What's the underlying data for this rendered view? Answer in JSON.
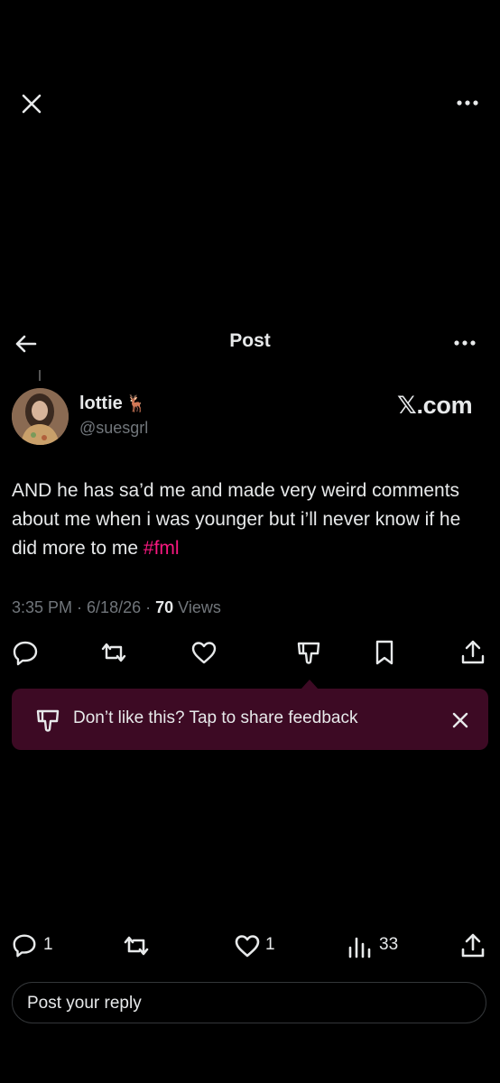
{
  "top_bar": {
    "close_icon": "close-icon",
    "more_icon": "more-icon"
  },
  "nav": {
    "title": "Post",
    "back_icon": "arrow-left-icon",
    "more_icon": "more-icon"
  },
  "post": {
    "display_name": "lottie",
    "name_emoji": "🦌",
    "handle": "@suesgrl",
    "badge_text": "𝕏.com",
    "text": "AND he has sa’d me and made very weird comments about me when i was younger but i’ll never know if he did more to me ",
    "hashtag": "#fml",
    "time": "3:35 PM",
    "date": "6/18/26",
    "views_count": "70",
    "views_label": "Views"
  },
  "feedback": {
    "text": "Don’t like this? Tap to share feedback"
  },
  "bottom_bar": {
    "reply_count": "1",
    "like_count": "1",
    "views_count": "33"
  },
  "reply_input": {
    "placeholder": "Post your reply"
  },
  "colors": {
    "accent": "#f91880",
    "feedback_bg": "#3d0a24",
    "muted": "#71767b"
  }
}
